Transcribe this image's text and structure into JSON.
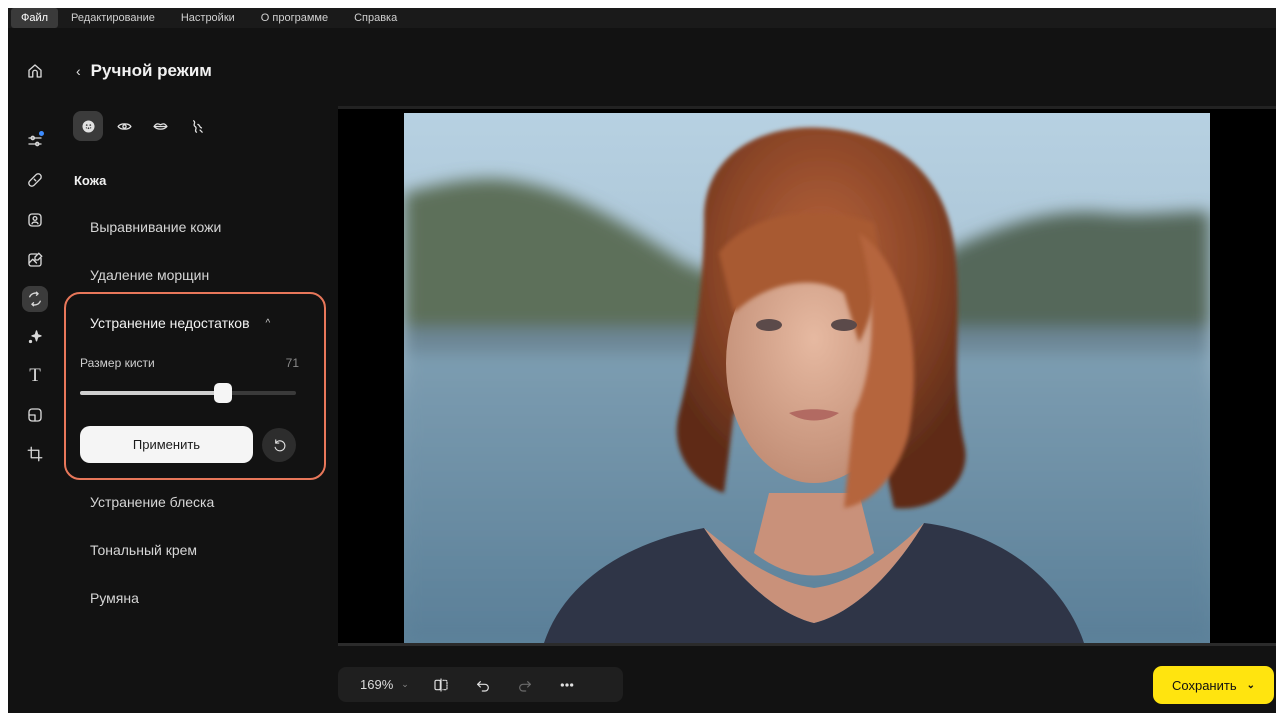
{
  "menu": {
    "items": [
      {
        "label": "Файл",
        "active": true
      },
      {
        "label": "Редактирование"
      },
      {
        "label": "Настройки"
      },
      {
        "label": "О программе"
      },
      {
        "label": "Справка"
      }
    ]
  },
  "rail": {
    "icons": [
      "home-icon",
      "adjustments-icon",
      "healing-brush-icon",
      "portrait-icon",
      "image-edit-icon",
      "retouch-icon",
      "sparkle-icon",
      "text-icon",
      "frame-icon",
      "crop-icon"
    ],
    "active": "retouch-icon",
    "text_glyph": "T",
    "notification_color": "#3d8cff"
  },
  "panel": {
    "back_glyph": "‹",
    "title": "Ручной режим",
    "tabs": [
      "face-skin-tab-icon",
      "eye-tab-icon",
      "lips-tab-icon",
      "hair-tab-icon"
    ],
    "active_tab": "face-skin-tab-icon",
    "section_title": "Кожа",
    "items_before": [
      "Выравнивание кожи",
      "Удаление морщин"
    ],
    "expanded": {
      "title": "Устранение недостатков",
      "chevron": "^",
      "brush_label": "Размер кисти",
      "brush_value": "71",
      "brush_fraction": 0.66,
      "apply_label": "Применить",
      "highlight_color": "#e8775a"
    },
    "items_after": [
      "Устранение блеска",
      "Тональный крем",
      "Румяна"
    ]
  },
  "toolbar": {
    "zoom": "169%",
    "zoom_chevron": "⌄",
    "icons": [
      "compare-icon",
      "undo-icon",
      "redo-icon",
      "more-icon"
    ]
  },
  "save": {
    "label": "Сохранить",
    "chevron": "⌄",
    "color": "#ffe40f"
  }
}
